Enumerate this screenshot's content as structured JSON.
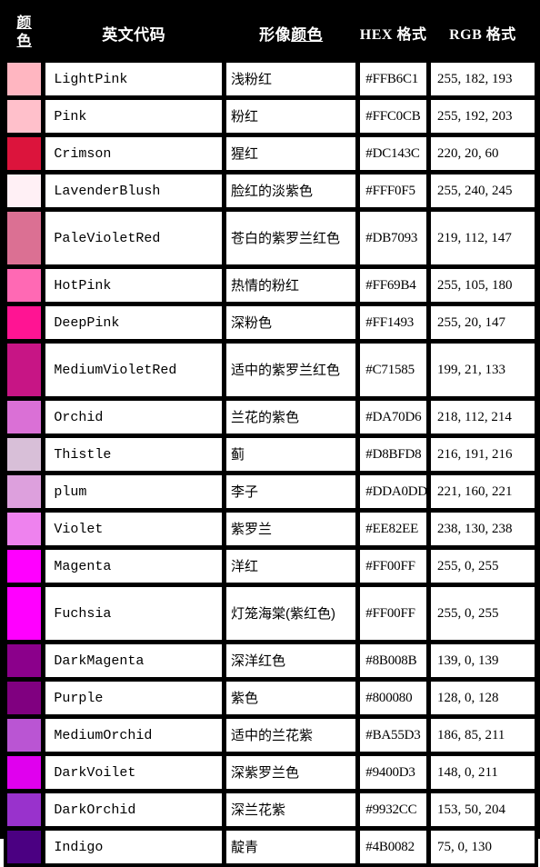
{
  "table": {
    "headers": {
      "swatch": "颜色",
      "swatch_line1": "颜",
      "swatch_line2": "色",
      "english_code": "英文代码",
      "image_color": "形像颜色",
      "image_color_plain": "形像",
      "image_color_link": "颜色",
      "hex_format": "HEX 格式",
      "rgb_format": "RGB 格式"
    },
    "header_bg": "#000000",
    "header_fg": "#FFFFFF",
    "border_color": "#000000",
    "cell_bg": "#FFFFFF",
    "rows": [
      {
        "swatch_name": "swatch-lightpink",
        "swatch_color": "#FFB6C1",
        "english_code": "LightPink",
        "chinese_name": "浅粉红",
        "hex": "#FFB6C1",
        "rgb": "255, 182, 193",
        "tall": false
      },
      {
        "swatch_name": "swatch-pink",
        "swatch_color": "#FFC0CB",
        "english_code": "Pink",
        "chinese_name": "粉红",
        "hex": "#FFC0CB",
        "rgb": "255, 192, 203",
        "tall": false
      },
      {
        "swatch_name": "swatch-crimson",
        "swatch_color": "#DC143C",
        "english_code": "Crimson",
        "chinese_name": "猩红",
        "hex": "#DC143C",
        "rgb": "220, 20, 60",
        "tall": false
      },
      {
        "swatch_name": "swatch-lavenderblush",
        "swatch_color": "#FFF0F5",
        "english_code": "LavenderBlush",
        "chinese_name": "脸红的淡紫色",
        "hex": "#FFF0F5",
        "rgb": "255, 240, 245",
        "tall": false
      },
      {
        "swatch_name": "swatch-palevioletred",
        "swatch_color": "#DB7093",
        "english_code": "PaleVioletRed",
        "chinese_name": "苍白的紫罗兰红色",
        "hex": "#DB7093",
        "rgb": "219, 112, 147",
        "tall": true
      },
      {
        "swatch_name": "swatch-hotpink",
        "swatch_color": "#FF69B4",
        "english_code": "HotPink",
        "chinese_name": "热情的粉红",
        "hex": "#FF69B4",
        "rgb": "255, 105, 180",
        "tall": false
      },
      {
        "swatch_name": "swatch-deeppink",
        "swatch_color": "#FF1493",
        "english_code": "DeepPink",
        "chinese_name": "深粉色",
        "hex": "#FF1493",
        "rgb": "255, 20, 147",
        "tall": false
      },
      {
        "swatch_name": "swatch-mediumvioletred",
        "swatch_color": "#C71585",
        "english_code": "MediumVioletRed",
        "chinese_name": "适中的紫罗兰红色",
        "hex": "#C71585",
        "rgb": "199, 21, 133",
        "tall": true
      },
      {
        "swatch_name": "swatch-orchid",
        "swatch_color": "#DA70D6",
        "english_code": "Orchid",
        "chinese_name": "兰花的紫色",
        "hex": "#DA70D6",
        "rgb": "218, 112, 214",
        "tall": false
      },
      {
        "swatch_name": "swatch-thistle",
        "swatch_color": "#D8BFD8",
        "english_code": "Thistle",
        "chinese_name": "蓟",
        "hex": "#D8BFD8",
        "rgb": "216, 191, 216",
        "tall": false
      },
      {
        "swatch_name": "swatch-plum",
        "swatch_color": "#DDA0DD",
        "english_code": "plum",
        "chinese_name": "李子",
        "hex": "#DDA0DD",
        "rgb": "221, 160, 221",
        "tall": false
      },
      {
        "swatch_name": "swatch-violet",
        "swatch_color": "#EE82EE",
        "english_code": "Violet",
        "chinese_name": "紫罗兰",
        "hex": "#EE82EE",
        "rgb": "238, 130, 238",
        "tall": false
      },
      {
        "swatch_name": "swatch-magenta",
        "swatch_color": "#FF00FF",
        "english_code": "Magenta",
        "chinese_name": "洋红",
        "hex": "#FF00FF",
        "rgb": "255, 0, 255",
        "tall": false
      },
      {
        "swatch_name": "swatch-fuchsia",
        "swatch_color": "#FF00FF",
        "english_code": "Fuchsia",
        "chinese_name": "灯笼海棠(紫红色)",
        "hex": "#FF00FF",
        "rgb": "255, 0, 255",
        "tall": true
      },
      {
        "swatch_name": "swatch-darkmagenta",
        "swatch_color": "#8B008B",
        "english_code": "DarkMagenta",
        "chinese_name": "深洋红色",
        "hex": "#8B008B",
        "rgb": "139, 0, 139",
        "tall": false
      },
      {
        "swatch_name": "swatch-purple",
        "swatch_color": "#800080",
        "english_code": "Purple",
        "chinese_name": "紫色",
        "hex": "#800080",
        "rgb": "128, 0, 128",
        "tall": false
      },
      {
        "swatch_name": "swatch-mediumorchid",
        "swatch_color": "#BA55D3",
        "english_code": "MediumOrchid",
        "chinese_name": "适中的兰花紫",
        "hex": "#BA55D3",
        "rgb": "186, 85, 211",
        "tall": false
      },
      {
        "swatch_name": "swatch-darkvoilet",
        "swatch_color": "#E000EE",
        "english_code": "DarkVoilet",
        "chinese_name": "深紫罗兰色",
        "hex": "#9400D3",
        "rgb": "148, 0, 211",
        "tall": false
      },
      {
        "swatch_name": "swatch-darkorchid",
        "swatch_color": "#9932CC",
        "english_code": "DarkOrchid",
        "chinese_name": "深兰花紫",
        "hex": "#9932CC",
        "rgb": "153, 50, 204",
        "tall": false
      },
      {
        "swatch_name": "swatch-indigo",
        "swatch_color": "#4B0082",
        "english_code": "Indigo",
        "chinese_name": "靛青",
        "hex": "#4B0082",
        "rgb": "75, 0, 130",
        "tall": false
      }
    ]
  }
}
